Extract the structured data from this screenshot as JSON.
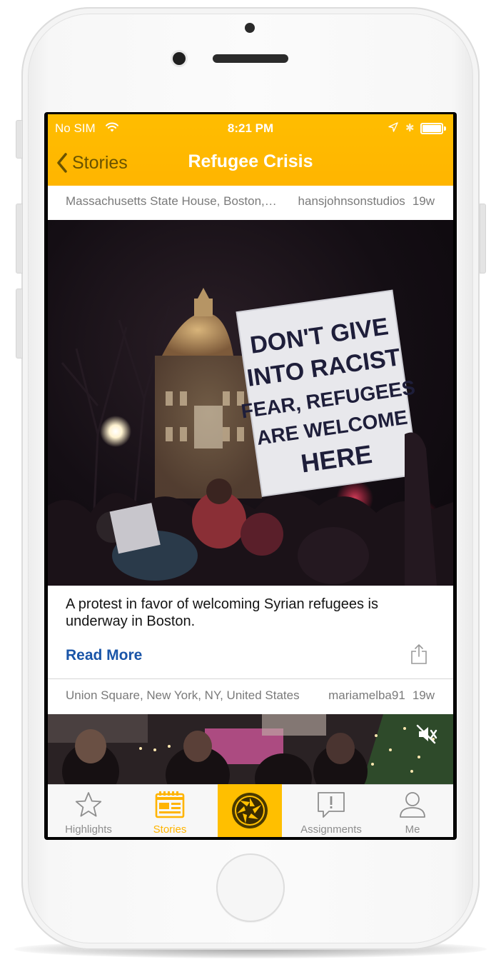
{
  "status_bar": {
    "carrier": "No SIM",
    "time": "8:21 PM"
  },
  "nav": {
    "back_label": "Stories",
    "title": "Refugee Crisis"
  },
  "posts": [
    {
      "location": "Massachusetts State House, Boston, MA, United States",
      "user": "hansjohnsonstudios",
      "age": "19w",
      "caption": "A protest in favor of welcoming Syrian refugees is underway in Boston.",
      "read_more": "Read More",
      "sign_text": [
        "DON'T GIVE",
        "INTO RACIST",
        "FEAR, REFUGEES",
        "ARE WELCOME",
        "HERE"
      ]
    },
    {
      "location": "Union Square, New York, NY, United States",
      "user": "mariamelba91",
      "age": "19w"
    }
  ],
  "tabs": [
    {
      "label": "Highlights",
      "icon": "star-icon"
    },
    {
      "label": "Stories",
      "icon": "stories-icon"
    },
    {
      "label": "",
      "icon": "camera-shutter-icon"
    },
    {
      "label": "Assignments",
      "icon": "assignments-icon"
    },
    {
      "label": "Me",
      "icon": "person-icon"
    }
  ],
  "colors": {
    "accent": "#ffb400",
    "link": "#1a55a8",
    "header_text": "#6a5300"
  }
}
